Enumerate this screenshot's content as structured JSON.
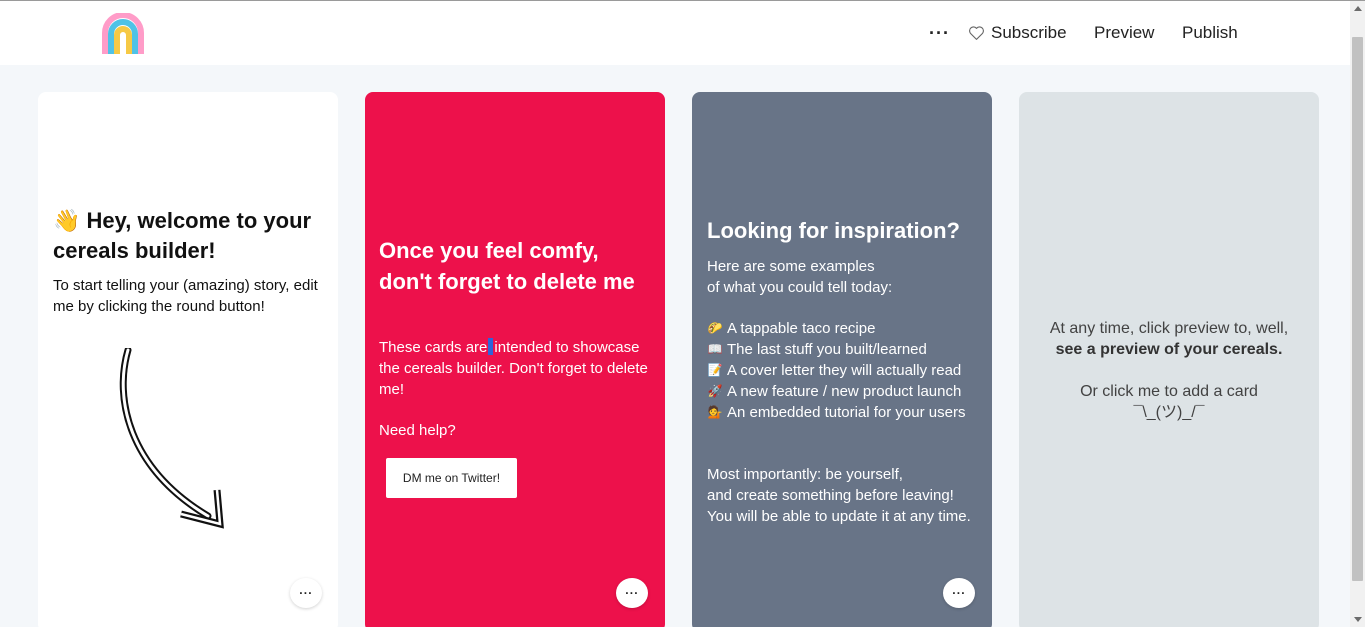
{
  "colors": {
    "page_bg": "#f4f7fa",
    "card_white": "#ffffff",
    "card_red": "#ed114b",
    "card_slate": "#687487",
    "card_light": "#dde3e6"
  },
  "header": {
    "logo_icon": "rainbow-icon",
    "more_label": "···",
    "subscribe_label": "Subscribe",
    "subscribe_icon": "heart-outline-icon",
    "preview_label": "Preview",
    "publish_label": "Publish"
  },
  "cards": [
    {
      "title_emoji": "👋",
      "title": "Hey, welcome to your cereals builder!",
      "body": "To start telling your (amazing) story, edit me by clicking the round button!",
      "decoration_icon": "curved-arrow-icon",
      "menu_label": "···"
    },
    {
      "title": "Once you feel comfy, don't forget to delete me",
      "body_before_cursor": "These cards are",
      "body_after_cursor": "intended to showcase the cereals builder. Don't forget to delete me!",
      "help_text": "Need help?",
      "button_label": "DM me on Twitter!",
      "menu_label": "···"
    },
    {
      "title": "Looking for inspiration?",
      "intro_line1": "Here are some examples",
      "intro_line2": "of what you could tell today:",
      "items": [
        {
          "emoji": "🌮",
          "text": "A tappable taco recipe"
        },
        {
          "emoji": "📖",
          "text": "The last stuff you built/learned"
        },
        {
          "emoji": "📝",
          "text": "A cover letter they will actually read"
        },
        {
          "emoji": "🚀",
          "text": "A new feature / new product launch"
        },
        {
          "emoji": "💁",
          "text": "An embedded tutorial for your users"
        }
      ],
      "outro_line1": "Most importantly: be yourself,",
      "outro_line2": "and create something before leaving!",
      "outro_line3": "You will be able to update it at any time.",
      "menu_label": "···"
    },
    {
      "line1": "At any time, click preview to, well,",
      "line2": "see a preview of your cereals.",
      "line3": "Or click me to add a card",
      "shrug": "¯\\_(ツ)_/¯"
    }
  ]
}
